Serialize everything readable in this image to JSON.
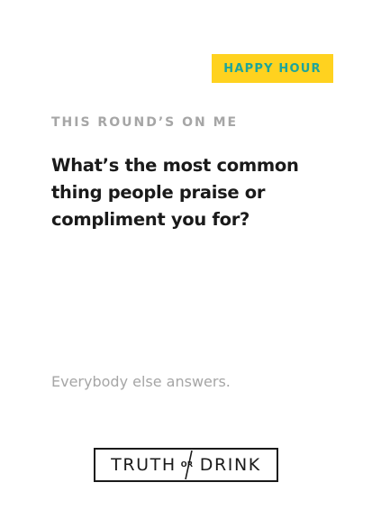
{
  "card": {
    "tag": "HAPPY HOUR",
    "round_label": "THIS ROUND’S ON ME",
    "question": "What’s the most common thing people praise or compliment you for?",
    "instruction": "Everybody else answers.",
    "logo": {
      "left_word": "TRUTH",
      "middle_word": "OR",
      "right_word": "DRINK"
    }
  },
  "colors": {
    "tag_background": "#FFD21F",
    "tag_text": "#1EA59A",
    "muted_text": "#A6A6A6",
    "primary_text": "#1A1A1A",
    "background": "#FFFFFF"
  }
}
